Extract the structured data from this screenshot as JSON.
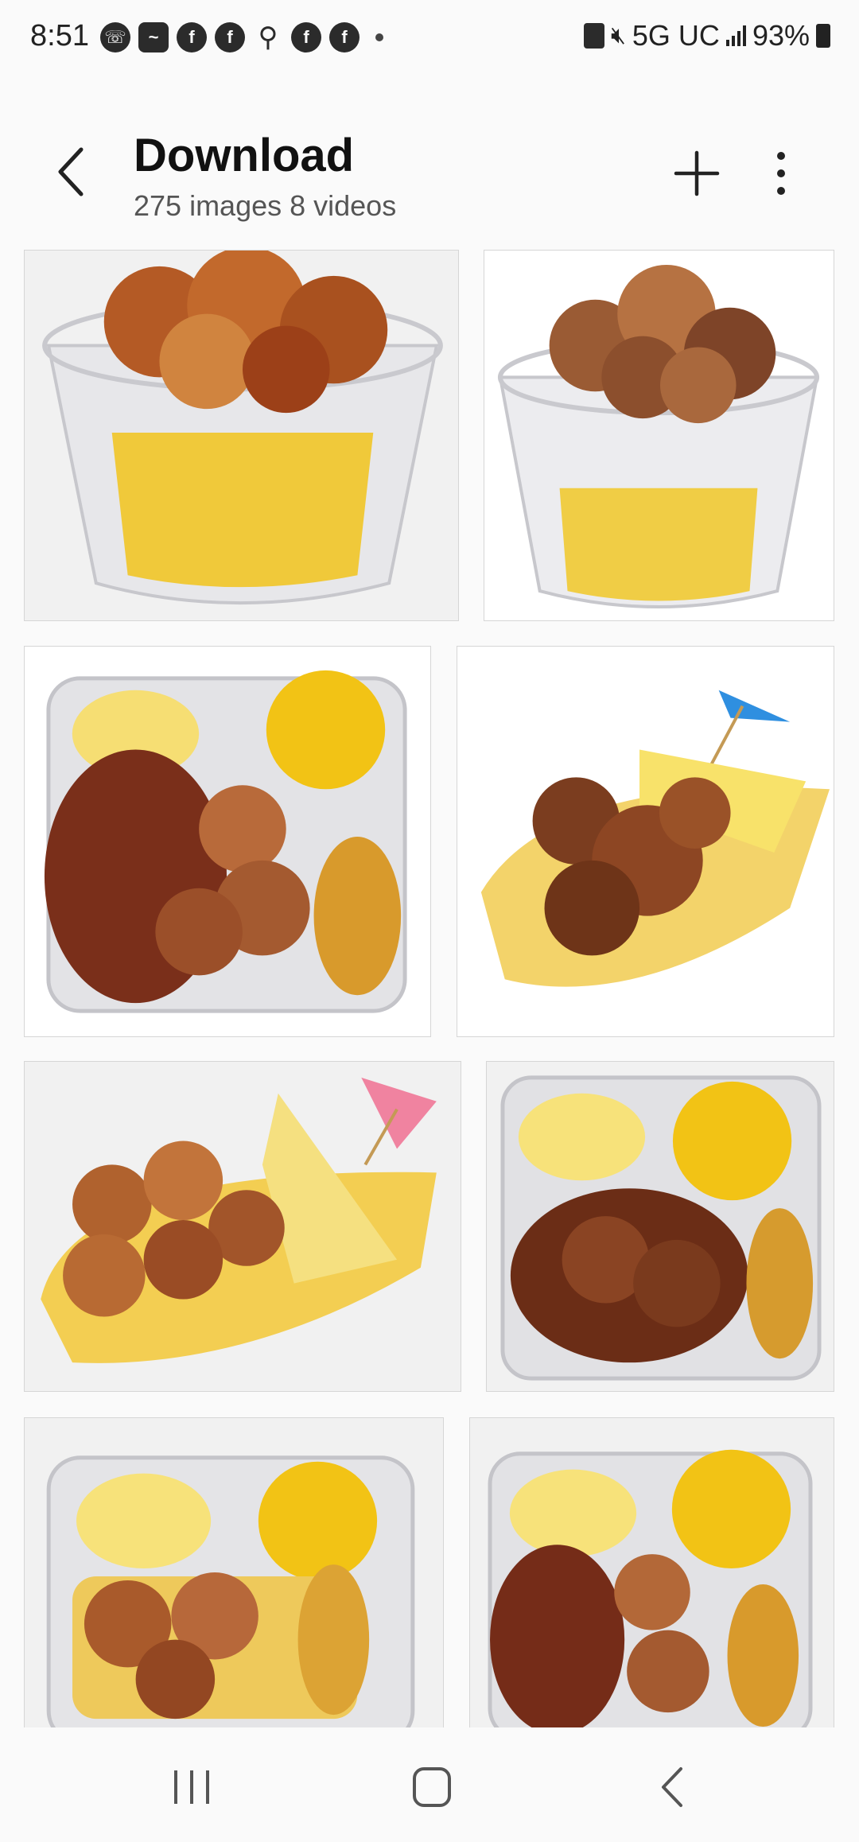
{
  "status_bar": {
    "time": "8:51",
    "network": "5G UC",
    "battery": "93%",
    "notification_icons": [
      "whatsapp-icon",
      "app-icon",
      "facebook-icon",
      "facebook-icon",
      "contact-add-icon",
      "facebook-icon",
      "facebook-icon"
    ]
  },
  "header": {
    "title": "Download",
    "subtitle": "275 images 8 videos"
  },
  "gallery": {
    "items": [
      {
        "name": "shrimp-bowl-corn-rice"
      },
      {
        "name": "jerk-chicken-bowl-corn-rice"
      },
      {
        "name": "chicken-shrimp-platter-pineapple-corn"
      },
      {
        "name": "chicken-pineapple-boat-umbrella"
      },
      {
        "name": "shrimp-pineapple-boat-umbrella"
      },
      {
        "name": "chicken-platter-pineapple-corn-plantain"
      },
      {
        "name": "shrimp-platter-pineapple-corn-plantain"
      },
      {
        "name": "chicken-shrimp-platter-pineapple-corn-plantain"
      }
    ]
  },
  "colors": {
    "background": "#fafafa",
    "text_primary": "#111111",
    "text_secondary": "#555555"
  }
}
